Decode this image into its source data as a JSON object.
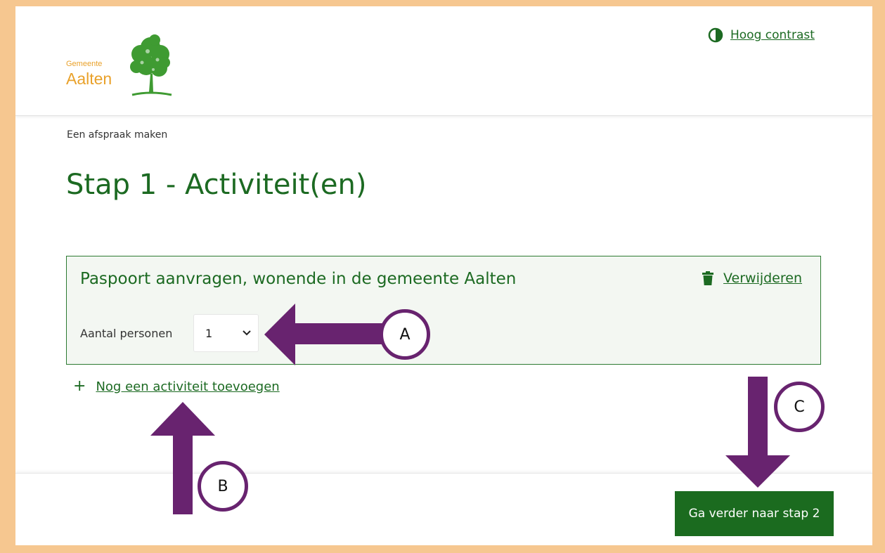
{
  "header": {
    "logo": {
      "small_text": "Gemeente",
      "big_text": "Aalten"
    },
    "contrast_label": "Hoog contrast"
  },
  "breadcrumb": "Een afspraak maken",
  "page_title": "Stap 1 - Activiteit(en)",
  "activity": {
    "title": "Paspoort aanvragen, wonende in de gemeente Aalten",
    "remove_label": "Verwijderen",
    "persons_label": "Aantal personen",
    "persons_value": "1"
  },
  "add_activity_label": "Nog een activiteit toevoegen",
  "next_button_label": "Ga verder naar stap 2",
  "annotations": {
    "a": "A",
    "b": "B",
    "c": "C"
  },
  "colors": {
    "primary_green": "#1c6a22",
    "logo_orange": "#e9a12a",
    "frame_peach": "#f6c790",
    "arrow_purple": "#68236f"
  },
  "icons": [
    "contrast-icon",
    "trash-icon",
    "chevron-down-icon",
    "plus-icon",
    "tree-logo-icon"
  ]
}
